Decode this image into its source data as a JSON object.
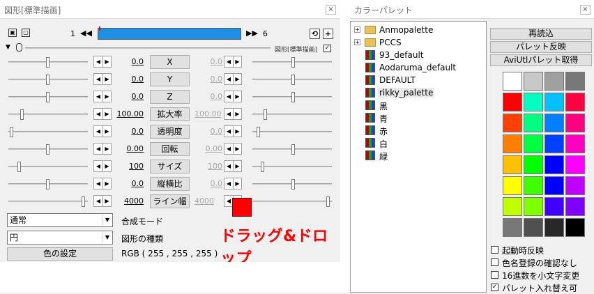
{
  "left": {
    "title": "図形[標準描画]",
    "close": "×",
    "frame_start": "1",
    "frame_end": "6",
    "nav_prev": "◀◀",
    "nav_next": "▶▶",
    "undo_icon": "⟲",
    "add_icon": "+",
    "expand_icon": "▼",
    "mode_text": "図形[標準描画]",
    "mode_checked": "✓",
    "spin_left": "◀",
    "spin_right": "▶",
    "params": [
      {
        "label": "X",
        "left": "0.0",
        "right": "0.0"
      },
      {
        "label": "Y",
        "left": "0.0",
        "right": "0.0"
      },
      {
        "label": "Z",
        "left": "0.0",
        "right": "0.0"
      },
      {
        "label": "拡大率",
        "left": "100.00",
        "right": "100.00"
      },
      {
        "label": "透明度",
        "left": "0.0",
        "right": "0.0"
      },
      {
        "label": "回転",
        "left": "0.00",
        "right": "0.00"
      },
      {
        "label": "サイズ",
        "left": "100",
        "right": "100"
      },
      {
        "label": "縦横比",
        "left": "0.0",
        "right": "0.0"
      },
      {
        "label": "ライン幅",
        "left": "4000",
        "right": "4000"
      }
    ],
    "blend_value": "通常",
    "blend_label": "合成モード",
    "shape_value": "円",
    "shape_label": "図形の種類",
    "color_button": "色の設定",
    "rgb_text": "RGB ( 255 , 255 , 255 )",
    "swatch_color": "#ff0000",
    "drag_text": "ドラッグ&ドロップ"
  },
  "right": {
    "title": "カラーパレット",
    "close": "×",
    "tree": [
      {
        "label": "Anmopalette",
        "type": "folder",
        "expander": "+"
      },
      {
        "label": "PCCS",
        "type": "folder",
        "expander": "+"
      },
      {
        "label": "93_default",
        "type": "palette"
      },
      {
        "label": "Aodaruma_default",
        "type": "palette"
      },
      {
        "label": "DEFAULT",
        "type": "palette"
      },
      {
        "label": "rikky_palette",
        "type": "palette",
        "selected": true
      },
      {
        "label": "黒",
        "type": "palette"
      },
      {
        "label": "青",
        "type": "palette"
      },
      {
        "label": "赤",
        "type": "palette"
      },
      {
        "label": "白",
        "type": "palette"
      },
      {
        "label": "緑",
        "type": "palette"
      }
    ],
    "buttons": [
      "再読込",
      "パレット反映",
      "AviUtlパレット取得"
    ],
    "colors": [
      "#ffffff",
      "#c8c8c8",
      "#a0a0a0",
      "#787878",
      "#ff0000",
      "#00ffc0",
      "#00c0ff",
      "#ff0040",
      "#ff4000",
      "#00ff80",
      "#0080ff",
      "#ff0080",
      "#ff8000",
      "#00ff40",
      "#0040ff",
      "#ff00c0",
      "#ffc000",
      "#00ff00",
      "#0000ff",
      "#ff00ff",
      "#ffff00",
      "#40ff00",
      "#0000ff",
      "#c000ff",
      "#c0ff00",
      "#80ff00",
      "#4000ff",
      "#8000ff",
      "#787878",
      "#505050",
      "#282828",
      "#000000"
    ],
    "checks": [
      {
        "label": "起動時反映",
        "checked": ""
      },
      {
        "label": "色名登録の確認なし",
        "checked": ""
      },
      {
        "label": "16進数を小文字変更",
        "checked": ""
      },
      {
        "label": "パレット入れ替え可",
        "checked": "✓"
      }
    ]
  }
}
